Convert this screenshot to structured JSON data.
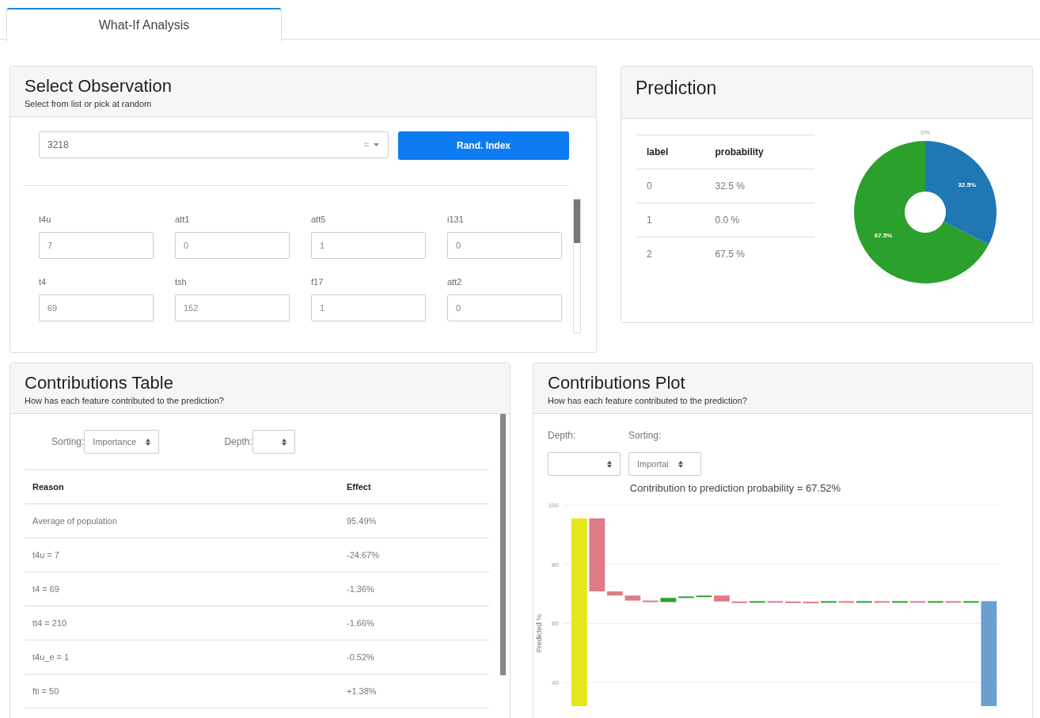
{
  "tabs": [
    {
      "label": "What-If Analysis",
      "selected": true
    }
  ],
  "select_observation": {
    "title": "Select Observation",
    "subtitle": "Select from list or pick at random",
    "index_value": "3218",
    "button": "Rand. Index",
    "features": [
      {
        "label": "t4u",
        "value": "7"
      },
      {
        "label": "att1",
        "value": "0"
      },
      {
        "label": "att5",
        "value": "1"
      },
      {
        "label": "i131",
        "value": "0"
      },
      {
        "label": "t4",
        "value": "69"
      },
      {
        "label": "tsh",
        "value": "152"
      },
      {
        "label": "f17",
        "value": "1"
      },
      {
        "label": "att2",
        "value": "0"
      }
    ]
  },
  "prediction": {
    "title": "Prediction",
    "columns": [
      "label",
      "probability"
    ],
    "rows": [
      [
        "0",
        "32.5 %"
      ],
      [
        "1",
        "0.0 %"
      ],
      [
        "2",
        "67.5 %"
      ]
    ],
    "chart_data": {
      "type": "donut",
      "values": [
        32.5,
        0,
        67.5
      ],
      "value_labels": [
        "32.5%",
        "0%",
        "67.5%"
      ]
    }
  },
  "contributions_table": {
    "title": "Contributions Table",
    "subtitle": "How has each feature contributed to the prediction?",
    "sorting_label": "Sorting:",
    "sorting_value": "Importance",
    "depth_label": "Depth:",
    "columns": [
      "Reason",
      "Effect"
    ],
    "rows": [
      [
        "Average of population",
        "95.49%"
      ],
      [
        "t4u = 7",
        "-24.67%"
      ],
      [
        "t4 = 69",
        "-1.36%"
      ],
      [
        "tt4 = 210",
        "-1.66%"
      ],
      [
        "t4u_e = 1",
        "-0.52%"
      ],
      [
        "fti = 50",
        "+1.38%"
      ]
    ]
  },
  "contributions_plot": {
    "title": "Contributions Plot",
    "subtitle": "How has each feature contributed to the prediction?",
    "depth_label": "Depth:",
    "sorting_label": "Sorting:",
    "sorting_value": "Importai",
    "chart_title": "Contribution to prediction probability = 67.52%",
    "y_axis_label": "Predicted %",
    "y_ticks": [
      "100",
      "80",
      "60",
      "40"
    ]
  }
}
